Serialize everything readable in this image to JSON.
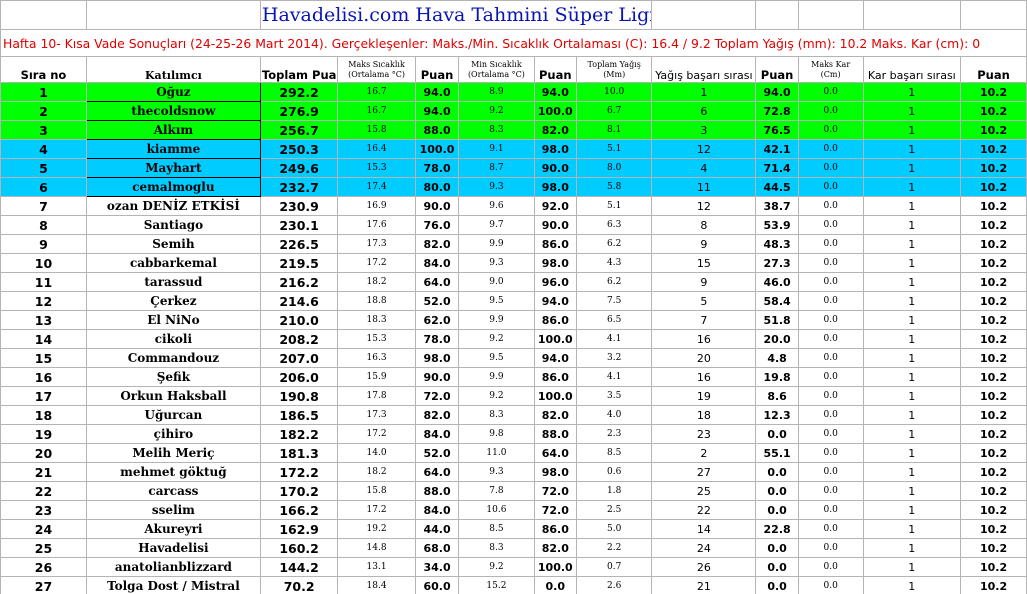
{
  "title": "Havadelisi.com Hava Tahmini Süper Ligi",
  "subtitle": "Hafta 10- Kısa Vade Sonuçları (24-25-26 Mart 2014). Gerçekleşenler: Maks./Min. Sıcaklık Ortalaması (C): 16.4 / 9.2 Toplam Yağış (mm): 10.2 Maks. Kar (cm): 0",
  "colors": {
    "title": "#0a14b4",
    "subtitle": "#e00000",
    "top3": "#00ff00",
    "next3": "#00ccff"
  },
  "headers": {
    "rank": "Sıra no",
    "participant": "Katılımcı",
    "total": "Toplam Puan",
    "max_temp": [
      "Maks Sıcaklık",
      "(Ortalama °C)"
    ],
    "points1": "Puan",
    "min_temp": [
      "Min Sıcaklık",
      "(Ortalama °C)"
    ],
    "points2": "Puan",
    "precip": [
      "Toplam Yağış",
      "(Mm)"
    ],
    "precip_rank": "Yağış başarı sırası",
    "points3": "Puan",
    "snow": [
      "Maks Kar",
      "(Cm)"
    ],
    "snow_rank": "Kar başarı sırası",
    "points4": "Puan"
  },
  "rows": [
    {
      "rank": "1",
      "name": "Oğuz",
      "total": "292.2",
      "tmax": "16.7",
      "p1": "94.0",
      "tmin": "8.9",
      "p2": "94.0",
      "rain": "10.0",
      "rrank": "1",
      "p3": "94.0",
      "snow": "0.0",
      "srank": "1",
      "p4": "10.2",
      "hl": "green"
    },
    {
      "rank": "2",
      "name": "thecoldsnow",
      "total": "276.9",
      "tmax": "16.7",
      "p1": "94.0",
      "tmin": "9.2",
      "p2": "100.0",
      "rain": "6.7",
      "rrank": "6",
      "p3": "72.8",
      "snow": "0.0",
      "srank": "1",
      "p4": "10.2",
      "hl": "green"
    },
    {
      "rank": "3",
      "name": "Alkım",
      "total": "256.7",
      "tmax": "15.8",
      "p1": "88.0",
      "tmin": "8.3",
      "p2": "82.0",
      "rain": "8.1",
      "rrank": "3",
      "p3": "76.5",
      "snow": "0.0",
      "srank": "1",
      "p4": "10.2",
      "hl": "green"
    },
    {
      "rank": "4",
      "name": "kiamme",
      "total": "250.3",
      "tmax": "16.4",
      "p1": "100.0",
      "tmin": "9.1",
      "p2": "98.0",
      "rain": "5.1",
      "rrank": "12",
      "p3": "42.1",
      "snow": "0.0",
      "srank": "1",
      "p4": "10.2",
      "hl": "cyan"
    },
    {
      "rank": "5",
      "name": "Mayhart",
      "total": "249.6",
      "tmax": "15.3",
      "p1": "78.0",
      "tmin": "8.7",
      "p2": "90.0",
      "rain": "8.0",
      "rrank": "4",
      "p3": "71.4",
      "snow": "0.0",
      "srank": "1",
      "p4": "10.2",
      "hl": "cyan"
    },
    {
      "rank": "6",
      "name": "cemalmoglu",
      "total": "232.7",
      "tmax": "17.4",
      "p1": "80.0",
      "tmin": "9.3",
      "p2": "98.0",
      "rain": "5.8",
      "rrank": "11",
      "p3": "44.5",
      "snow": "0.0",
      "srank": "1",
      "p4": "10.2",
      "hl": "cyan"
    },
    {
      "rank": "7",
      "name": "ozan DENİZ ETKİSİ",
      "total": "230.9",
      "tmax": "16.9",
      "p1": "90.0",
      "tmin": "9.6",
      "p2": "92.0",
      "rain": "5.1",
      "rrank": "12",
      "p3": "38.7",
      "snow": "0.0",
      "srank": "1",
      "p4": "10.2",
      "hl": ""
    },
    {
      "rank": "8",
      "name": "Santiago",
      "total": "230.1",
      "tmax": "17.6",
      "p1": "76.0",
      "tmin": "9.7",
      "p2": "90.0",
      "rain": "6.3",
      "rrank": "8",
      "p3": "53.9",
      "snow": "0.0",
      "srank": "1",
      "p4": "10.2",
      "hl": ""
    },
    {
      "rank": "9",
      "name": "Semih",
      "total": "226.5",
      "tmax": "17.3",
      "p1": "82.0",
      "tmin": "9.9",
      "p2": "86.0",
      "rain": "6.2",
      "rrank": "9",
      "p3": "48.3",
      "snow": "0.0",
      "srank": "1",
      "p4": "10.2",
      "hl": ""
    },
    {
      "rank": "10",
      "name": "cabbarkemal",
      "total": "219.5",
      "tmax": "17.2",
      "p1": "84.0",
      "tmin": "9.3",
      "p2": "98.0",
      "rain": "4.3",
      "rrank": "15",
      "p3": "27.3",
      "snow": "0.0",
      "srank": "1",
      "p4": "10.2",
      "hl": ""
    },
    {
      "rank": "11",
      "name": "tarassud",
      "total": "216.2",
      "tmax": "18.2",
      "p1": "64.0",
      "tmin": "9.0",
      "p2": "96.0",
      "rain": "6.2",
      "rrank": "9",
      "p3": "46.0",
      "snow": "0.0",
      "srank": "1",
      "p4": "10.2",
      "hl": ""
    },
    {
      "rank": "12",
      "name": "Çerkez",
      "total": "214.6",
      "tmax": "18.8",
      "p1": "52.0",
      "tmin": "9.5",
      "p2": "94.0",
      "rain": "7.5",
      "rrank": "5",
      "p3": "58.4",
      "snow": "0.0",
      "srank": "1",
      "p4": "10.2",
      "hl": ""
    },
    {
      "rank": "13",
      "name": "El NiNo",
      "total": "210.0",
      "tmax": "18.3",
      "p1": "62.0",
      "tmin": "9.9",
      "p2": "86.0",
      "rain": "6.5",
      "rrank": "7",
      "p3": "51.8",
      "snow": "0.0",
      "srank": "1",
      "p4": "10.2",
      "hl": ""
    },
    {
      "rank": "14",
      "name": "cikoli",
      "total": "208.2",
      "tmax": "15.3",
      "p1": "78.0",
      "tmin": "9.2",
      "p2": "100.0",
      "rain": "4.1",
      "rrank": "16",
      "p3": "20.0",
      "snow": "0.0",
      "srank": "1",
      "p4": "10.2",
      "hl": ""
    },
    {
      "rank": "15",
      "name": "Commandouz",
      "total": "207.0",
      "tmax": "16.3",
      "p1": "98.0",
      "tmin": "9.5",
      "p2": "94.0",
      "rain": "3.2",
      "rrank": "20",
      "p3": "4.8",
      "snow": "0.0",
      "srank": "1",
      "p4": "10.2",
      "hl": ""
    },
    {
      "rank": "16",
      "name": "Şefik",
      "total": "206.0",
      "tmax": "15.9",
      "p1": "90.0",
      "tmin": "9.9",
      "p2": "86.0",
      "rain": "4.1",
      "rrank": "16",
      "p3": "19.8",
      "snow": "0.0",
      "srank": "1",
      "p4": "10.2",
      "hl": ""
    },
    {
      "rank": "17",
      "name": "Orkun Haksball",
      "total": "190.8",
      "tmax": "17.8",
      "p1": "72.0",
      "tmin": "9.2",
      "p2": "100.0",
      "rain": "3.5",
      "rrank": "19",
      "p3": "8.6",
      "snow": "0.0",
      "srank": "1",
      "p4": "10.2",
      "hl": ""
    },
    {
      "rank": "18",
      "name": "Uğurcan",
      "total": "186.5",
      "tmax": "17.3",
      "p1": "82.0",
      "tmin": "8.3",
      "p2": "82.0",
      "rain": "4.0",
      "rrank": "18",
      "p3": "12.3",
      "snow": "0.0",
      "srank": "1",
      "p4": "10.2",
      "hl": ""
    },
    {
      "rank": "19",
      "name": "çihiro",
      "total": "182.2",
      "tmax": "17.2",
      "p1": "84.0",
      "tmin": "9.8",
      "p2": "88.0",
      "rain": "2.3",
      "rrank": "23",
      "p3": "0.0",
      "snow": "0.0",
      "srank": "1",
      "p4": "10.2",
      "hl": ""
    },
    {
      "rank": "20",
      "name": "Melih Meriç",
      "total": "181.3",
      "tmax": "14.0",
      "p1": "52.0",
      "tmin": "11.0",
      "p2": "64.0",
      "rain": "8.5",
      "rrank": "2",
      "p3": "55.1",
      "snow": "0.0",
      "srank": "1",
      "p4": "10.2",
      "hl": ""
    },
    {
      "rank": "21",
      "name": "mehmet göktuğ",
      "total": "172.2",
      "tmax": "18.2",
      "p1": "64.0",
      "tmin": "9.3",
      "p2": "98.0",
      "rain": "0.6",
      "rrank": "27",
      "p3": "0.0",
      "snow": "0.0",
      "srank": "1",
      "p4": "10.2",
      "hl": ""
    },
    {
      "rank": "22",
      "name": "carcass",
      "total": "170.2",
      "tmax": "15.8",
      "p1": "88.0",
      "tmin": "7.8",
      "p2": "72.0",
      "rain": "1.8",
      "rrank": "25",
      "p3": "0.0",
      "snow": "0.0",
      "srank": "1",
      "p4": "10.2",
      "hl": ""
    },
    {
      "rank": "23",
      "name": "sselim",
      "total": "166.2",
      "tmax": "17.2",
      "p1": "84.0",
      "tmin": "10.6",
      "p2": "72.0",
      "rain": "2.5",
      "rrank": "22",
      "p3": "0.0",
      "snow": "0.0",
      "srank": "1",
      "p4": "10.2",
      "hl": ""
    },
    {
      "rank": "24",
      "name": "Akureyri",
      "total": "162.9",
      "tmax": "19.2",
      "p1": "44.0",
      "tmin": "8.5",
      "p2": "86.0",
      "rain": "5.0",
      "rrank": "14",
      "p3": "22.8",
      "snow": "0.0",
      "srank": "1",
      "p4": "10.2",
      "hl": ""
    },
    {
      "rank": "25",
      "name": "Havadelisi",
      "total": "160.2",
      "tmax": "14.8",
      "p1": "68.0",
      "tmin": "8.3",
      "p2": "82.0",
      "rain": "2.2",
      "rrank": "24",
      "p3": "0.0",
      "snow": "0.0",
      "srank": "1",
      "p4": "10.2",
      "hl": ""
    },
    {
      "rank": "26",
      "name": "anatolianblizzard",
      "total": "144.2",
      "tmax": "13.1",
      "p1": "34.0",
      "tmin": "9.2",
      "p2": "100.0",
      "rain": "0.7",
      "rrank": "26",
      "p3": "0.0",
      "snow": "0.0",
      "srank": "1",
      "p4": "10.2",
      "hl": ""
    },
    {
      "rank": "27",
      "name": "Tolga Dost / Mistral",
      "total": "70.2",
      "tmax": "18.4",
      "p1": "60.0",
      "tmin": "15.2",
      "p2": "0.0",
      "rain": "2.6",
      "rrank": "21",
      "p3": "0.0",
      "snow": "0.0",
      "srank": "1",
      "p4": "10.2",
      "hl": ""
    }
  ]
}
